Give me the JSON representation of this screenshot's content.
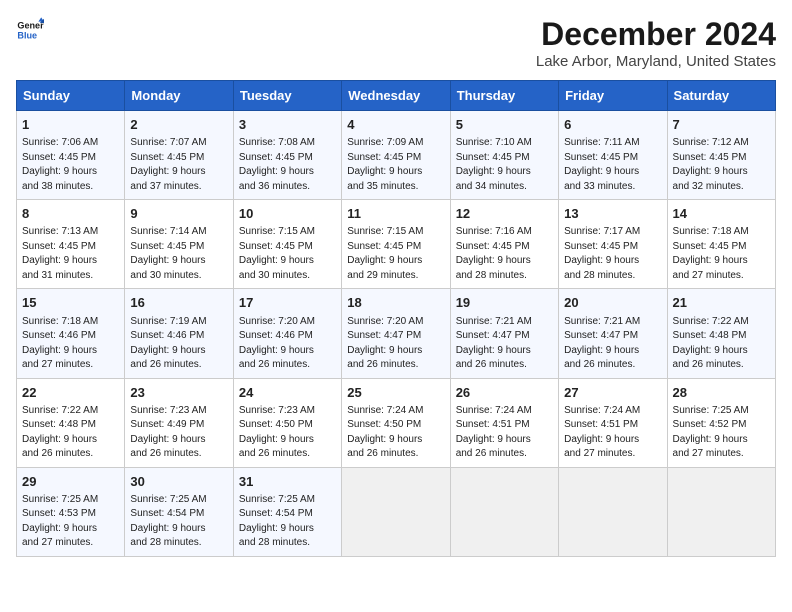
{
  "logo": {
    "line1": "General",
    "line2": "Blue"
  },
  "title": "December 2024",
  "location": "Lake Arbor, Maryland, United States",
  "weekdays": [
    "Sunday",
    "Monday",
    "Tuesday",
    "Wednesday",
    "Thursday",
    "Friday",
    "Saturday"
  ],
  "weeks": [
    [
      {
        "day": "1",
        "info": "Sunrise: 7:06 AM\nSunset: 4:45 PM\nDaylight: 9 hours\nand 38 minutes."
      },
      {
        "day": "2",
        "info": "Sunrise: 7:07 AM\nSunset: 4:45 PM\nDaylight: 9 hours\nand 37 minutes."
      },
      {
        "day": "3",
        "info": "Sunrise: 7:08 AM\nSunset: 4:45 PM\nDaylight: 9 hours\nand 36 minutes."
      },
      {
        "day": "4",
        "info": "Sunrise: 7:09 AM\nSunset: 4:45 PM\nDaylight: 9 hours\nand 35 minutes."
      },
      {
        "day": "5",
        "info": "Sunrise: 7:10 AM\nSunset: 4:45 PM\nDaylight: 9 hours\nand 34 minutes."
      },
      {
        "day": "6",
        "info": "Sunrise: 7:11 AM\nSunset: 4:45 PM\nDaylight: 9 hours\nand 33 minutes."
      },
      {
        "day": "7",
        "info": "Sunrise: 7:12 AM\nSunset: 4:45 PM\nDaylight: 9 hours\nand 32 minutes."
      }
    ],
    [
      {
        "day": "8",
        "info": "Sunrise: 7:13 AM\nSunset: 4:45 PM\nDaylight: 9 hours\nand 31 minutes."
      },
      {
        "day": "9",
        "info": "Sunrise: 7:14 AM\nSunset: 4:45 PM\nDaylight: 9 hours\nand 30 minutes."
      },
      {
        "day": "10",
        "info": "Sunrise: 7:15 AM\nSunset: 4:45 PM\nDaylight: 9 hours\nand 30 minutes."
      },
      {
        "day": "11",
        "info": "Sunrise: 7:15 AM\nSunset: 4:45 PM\nDaylight: 9 hours\nand 29 minutes."
      },
      {
        "day": "12",
        "info": "Sunrise: 7:16 AM\nSunset: 4:45 PM\nDaylight: 9 hours\nand 28 minutes."
      },
      {
        "day": "13",
        "info": "Sunrise: 7:17 AM\nSunset: 4:45 PM\nDaylight: 9 hours\nand 28 minutes."
      },
      {
        "day": "14",
        "info": "Sunrise: 7:18 AM\nSunset: 4:45 PM\nDaylight: 9 hours\nand 27 minutes."
      }
    ],
    [
      {
        "day": "15",
        "info": "Sunrise: 7:18 AM\nSunset: 4:46 PM\nDaylight: 9 hours\nand 27 minutes."
      },
      {
        "day": "16",
        "info": "Sunrise: 7:19 AM\nSunset: 4:46 PM\nDaylight: 9 hours\nand 26 minutes."
      },
      {
        "day": "17",
        "info": "Sunrise: 7:20 AM\nSunset: 4:46 PM\nDaylight: 9 hours\nand 26 minutes."
      },
      {
        "day": "18",
        "info": "Sunrise: 7:20 AM\nSunset: 4:47 PM\nDaylight: 9 hours\nand 26 minutes."
      },
      {
        "day": "19",
        "info": "Sunrise: 7:21 AM\nSunset: 4:47 PM\nDaylight: 9 hours\nand 26 minutes."
      },
      {
        "day": "20",
        "info": "Sunrise: 7:21 AM\nSunset: 4:47 PM\nDaylight: 9 hours\nand 26 minutes."
      },
      {
        "day": "21",
        "info": "Sunrise: 7:22 AM\nSunset: 4:48 PM\nDaylight: 9 hours\nand 26 minutes."
      }
    ],
    [
      {
        "day": "22",
        "info": "Sunrise: 7:22 AM\nSunset: 4:48 PM\nDaylight: 9 hours\nand 26 minutes."
      },
      {
        "day": "23",
        "info": "Sunrise: 7:23 AM\nSunset: 4:49 PM\nDaylight: 9 hours\nand 26 minutes."
      },
      {
        "day": "24",
        "info": "Sunrise: 7:23 AM\nSunset: 4:50 PM\nDaylight: 9 hours\nand 26 minutes."
      },
      {
        "day": "25",
        "info": "Sunrise: 7:24 AM\nSunset: 4:50 PM\nDaylight: 9 hours\nand 26 minutes."
      },
      {
        "day": "26",
        "info": "Sunrise: 7:24 AM\nSunset: 4:51 PM\nDaylight: 9 hours\nand 26 minutes."
      },
      {
        "day": "27",
        "info": "Sunrise: 7:24 AM\nSunset: 4:51 PM\nDaylight: 9 hours\nand 27 minutes."
      },
      {
        "day": "28",
        "info": "Sunrise: 7:25 AM\nSunset: 4:52 PM\nDaylight: 9 hours\nand 27 minutes."
      }
    ],
    [
      {
        "day": "29",
        "info": "Sunrise: 7:25 AM\nSunset: 4:53 PM\nDaylight: 9 hours\nand 27 minutes."
      },
      {
        "day": "30",
        "info": "Sunrise: 7:25 AM\nSunset: 4:54 PM\nDaylight: 9 hours\nand 28 minutes."
      },
      {
        "day": "31",
        "info": "Sunrise: 7:25 AM\nSunset: 4:54 PM\nDaylight: 9 hours\nand 28 minutes."
      },
      {
        "day": "",
        "info": ""
      },
      {
        "day": "",
        "info": ""
      },
      {
        "day": "",
        "info": ""
      },
      {
        "day": "",
        "info": ""
      }
    ]
  ]
}
